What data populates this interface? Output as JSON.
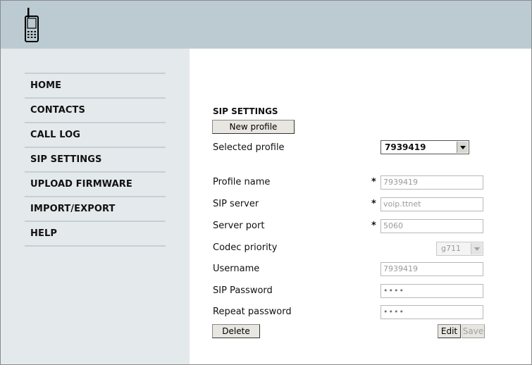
{
  "nav": {
    "items": [
      {
        "label": "HOME"
      },
      {
        "label": "CONTACTS"
      },
      {
        "label": "CALL LOG"
      },
      {
        "label": "SIP SETTINGS"
      },
      {
        "label": "UPLOAD FIRMWARE"
      },
      {
        "label": "IMPORT/EXPORT"
      },
      {
        "label": "HELP"
      }
    ]
  },
  "sip": {
    "title": "SIP SETTINGS",
    "new_profile_label": "New profile",
    "selected_profile_label": "Selected profile",
    "selected_profile_value": "7939419",
    "required_mark": "*",
    "profile_name_label": "Profile name",
    "profile_name_value": "7939419",
    "sip_server_label": "SIP server",
    "sip_server_value": "voip.ttnet",
    "server_port_label": "Server port",
    "server_port_value": "5060",
    "codec_priority_label": "Codec priority",
    "codec_priority_value": "g711",
    "username_label": "Username",
    "username_value": "7939419",
    "sip_password_label": "SIP Password",
    "sip_password_value": "••••",
    "repeat_password_label": "Repeat password",
    "repeat_password_value": "••••",
    "delete_label": "Delete",
    "edit_label": "Edit",
    "save_label": "Save"
  },
  "colors": {
    "header_bg": "#bccbd2",
    "sidebar_bg": "#e4e9ec"
  }
}
